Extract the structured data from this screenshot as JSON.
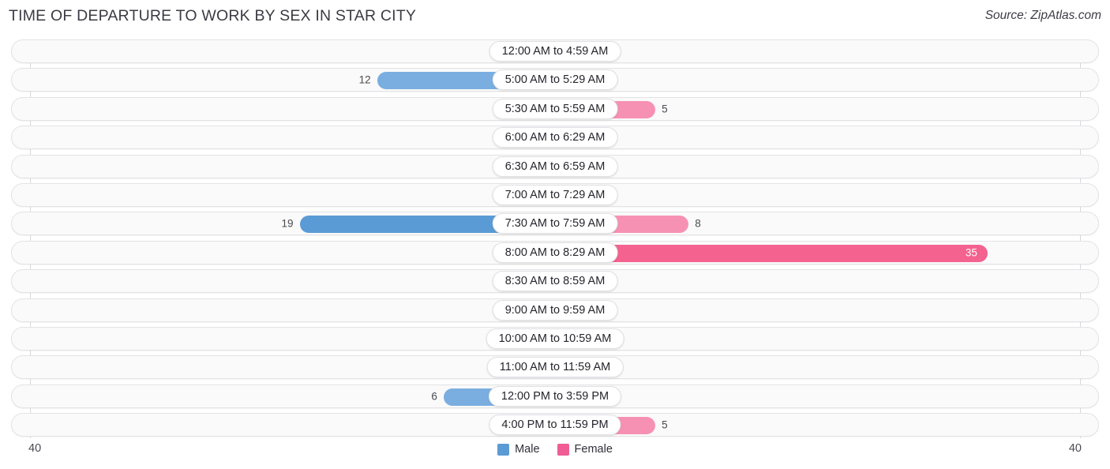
{
  "header": {
    "title": "TIME OF DEPARTURE TO WORK BY SEX IN STAR CITY",
    "source": "Source: ZipAtlas.com"
  },
  "axis": {
    "left_max_label": "40",
    "right_max_label": "40",
    "max": 40
  },
  "legend": {
    "items": [
      {
        "label": "Male",
        "color": "#5b9bd5"
      },
      {
        "label": "Female",
        "color": "#ef5d94"
      }
    ]
  },
  "colors": {
    "male_light": "#a8c8ec",
    "male_mid": "#7aaee0",
    "male_dark": "#5b9bd5",
    "female_light": "#f9a8c4",
    "female_mid": "#f791b4",
    "female_dark": "#f4628f",
    "row_bg": "#fafafa",
    "row_border": "#e3e3e6"
  },
  "chart_data": {
    "type": "bar",
    "title": "TIME OF DEPARTURE TO WORK BY SEX IN STAR CITY",
    "orientation": "horizontal-diverging",
    "xlabel": "",
    "ylabel": "",
    "xlim": [
      40,
      40
    ],
    "grid": false,
    "legend_position": "bottom-center",
    "categories": [
      "12:00 AM to 4:59 AM",
      "5:00 AM to 5:29 AM",
      "5:30 AM to 5:59 AM",
      "6:00 AM to 6:29 AM",
      "6:30 AM to 6:59 AM",
      "7:00 AM to 7:29 AM",
      "7:30 AM to 7:59 AM",
      "8:00 AM to 8:29 AM",
      "8:30 AM to 8:59 AM",
      "9:00 AM to 9:59 AM",
      "10:00 AM to 10:59 AM",
      "11:00 AM to 11:59 AM",
      "12:00 PM to 3:59 PM",
      "4:00 PM to 11:59 PM"
    ],
    "series": [
      {
        "name": "Male",
        "side": "left",
        "values": [
          0,
          12,
          0,
          0,
          0,
          0,
          19,
          0,
          0,
          0,
          0,
          0,
          6,
          0
        ]
      },
      {
        "name": "Female",
        "side": "right",
        "values": [
          0,
          0,
          5,
          0,
          0,
          0,
          8,
          35,
          0,
          0,
          0,
          0,
          0,
          5
        ]
      }
    ]
  },
  "rows": [
    {
      "label": "12:00 AM to 4:59 AM",
      "male": "0",
      "female": "0"
    },
    {
      "label": "5:00 AM to 5:29 AM",
      "male": "12",
      "female": "0"
    },
    {
      "label": "5:30 AM to 5:59 AM",
      "male": "0",
      "female": "5"
    },
    {
      "label": "6:00 AM to 6:29 AM",
      "male": "0",
      "female": "0"
    },
    {
      "label": "6:30 AM to 6:59 AM",
      "male": "0",
      "female": "0"
    },
    {
      "label": "7:00 AM to 7:29 AM",
      "male": "0",
      "female": "0"
    },
    {
      "label": "7:30 AM to 7:59 AM",
      "male": "19",
      "female": "8"
    },
    {
      "label": "8:00 AM to 8:29 AM",
      "male": "0",
      "female": "35"
    },
    {
      "label": "8:30 AM to 8:59 AM",
      "male": "0",
      "female": "0"
    },
    {
      "label": "9:00 AM to 9:59 AM",
      "male": "0",
      "female": "0"
    },
    {
      "label": "10:00 AM to 10:59 AM",
      "male": "0",
      "female": "0"
    },
    {
      "label": "11:00 AM to 11:59 AM",
      "male": "0",
      "female": "0"
    },
    {
      "label": "12:00 PM to 3:59 PM",
      "male": "6",
      "female": "0"
    },
    {
      "label": "4:00 PM to 11:59 PM",
      "male": "0",
      "female": "5"
    }
  ]
}
